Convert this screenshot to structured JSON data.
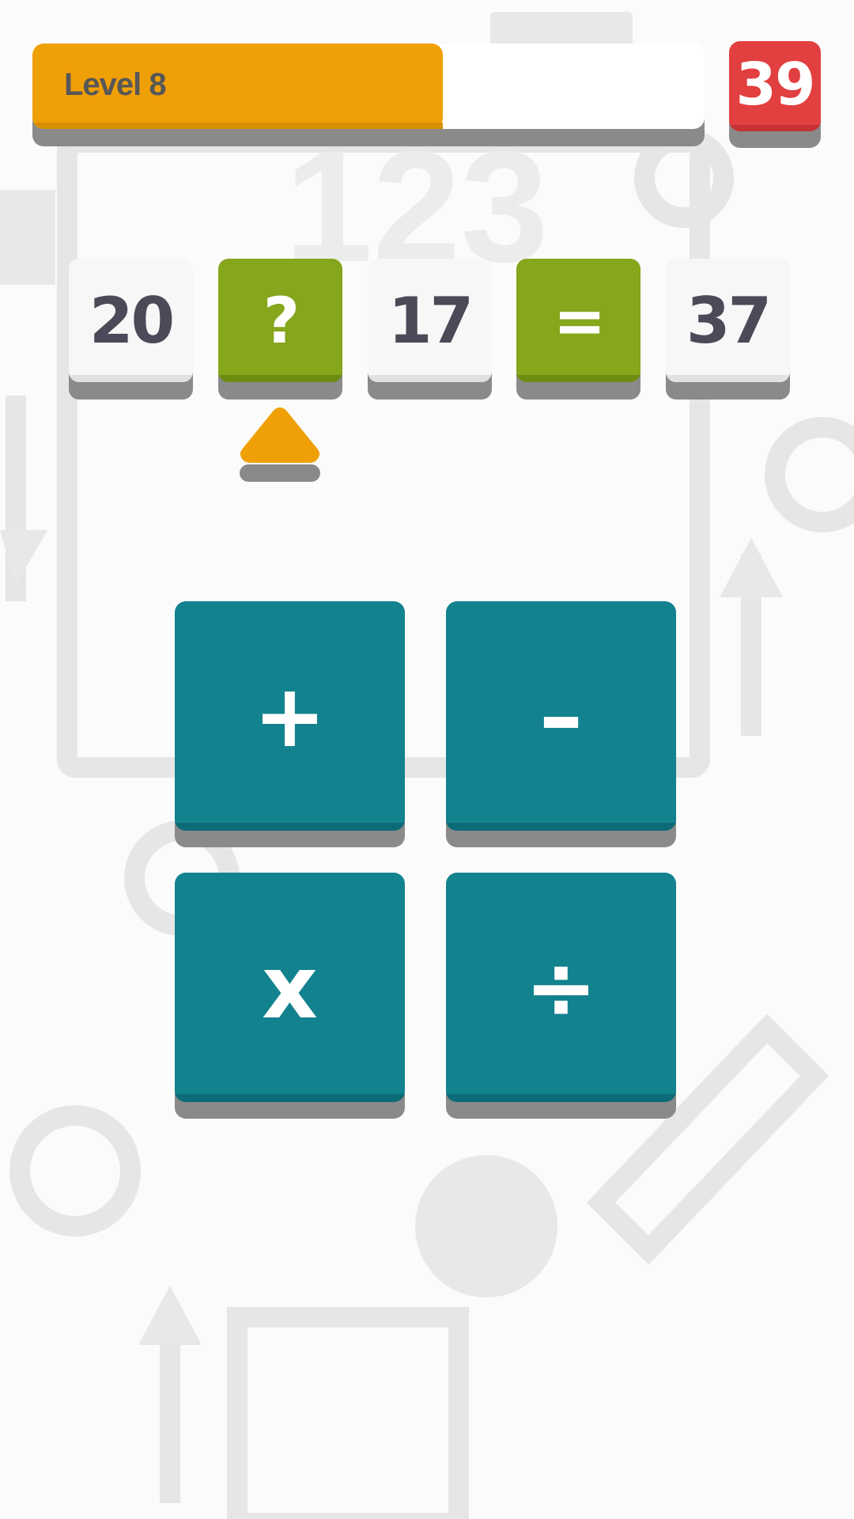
{
  "header": {
    "level_label": "Level 8",
    "progress": 0.61,
    "timer": "39"
  },
  "equation": {
    "tiles": [
      {
        "text": "20",
        "style": "white"
      },
      {
        "text": "?",
        "style": "green"
      },
      {
        "text": "17",
        "style": "white"
      },
      {
        "text": "=",
        "style": "green"
      },
      {
        "text": "37",
        "style": "white"
      }
    ]
  },
  "operators": {
    "plus": "+",
    "minus": "–",
    "times": "x",
    "divide": "÷"
  },
  "colors": {
    "progress_fill": "#f0a007",
    "timer_bg": "#e23f40",
    "tile_green": "#86a61c",
    "operator_teal": "#12828e",
    "pointer": "#f0a007"
  }
}
